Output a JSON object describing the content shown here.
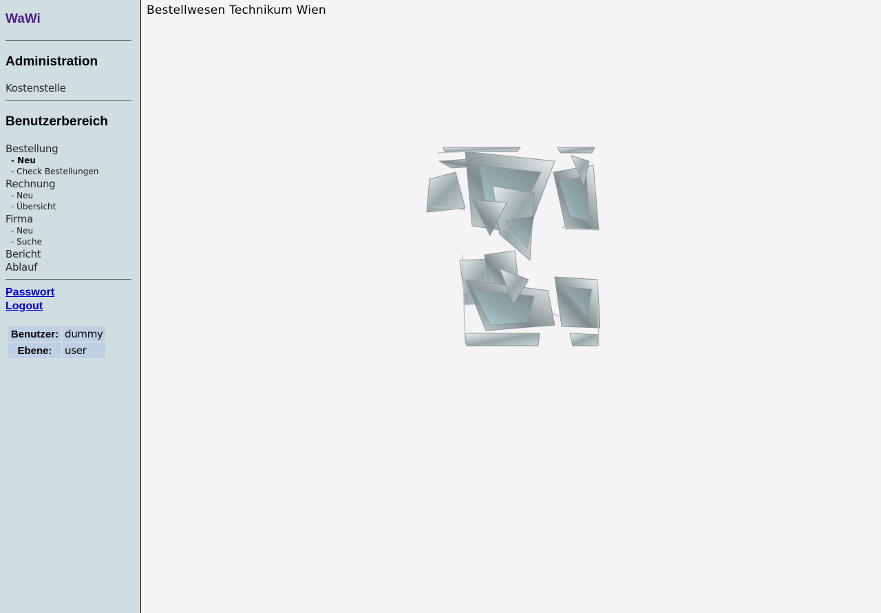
{
  "app": {
    "logo": "WaWi"
  },
  "sidebar": {
    "admin_heading": "Administration",
    "admin_items": [
      {
        "label": "Kostenstelle"
      }
    ],
    "user_heading": "Benutzerbereich",
    "nav": {
      "bestellung": {
        "label": "Bestellung",
        "sub": [
          {
            "label": "- Neu",
            "active": true
          },
          {
            "label": "- Check Bestellungen"
          }
        ]
      },
      "rechnung": {
        "label": "Rechnung",
        "sub": [
          {
            "label": "- Neu"
          },
          {
            "label": "- Übersicht"
          }
        ]
      },
      "firma": {
        "label": "Firma",
        "sub": [
          {
            "label": "- Neu"
          },
          {
            "label": "- Suche"
          }
        ]
      },
      "bericht": {
        "label": "Bericht"
      },
      "ablauf": {
        "label": "Ablauf"
      }
    },
    "links": {
      "passwort": "Passwort",
      "logout": "Logout"
    },
    "info": {
      "user_label": "Benutzer:",
      "user_value": "dummy",
      "level_label": "Ebene:",
      "level_value": "user"
    }
  },
  "main": {
    "title": "Bestellwesen Technikum Wien",
    "image_icon": "glass-shards-logo-icon"
  },
  "colors": {
    "sidebar_bg": "#d0dde1",
    "main_bg": "#f4f4f4",
    "logo": "#4b1d8a",
    "link": "#0000cc",
    "table_cell": "#bfcfe4"
  }
}
